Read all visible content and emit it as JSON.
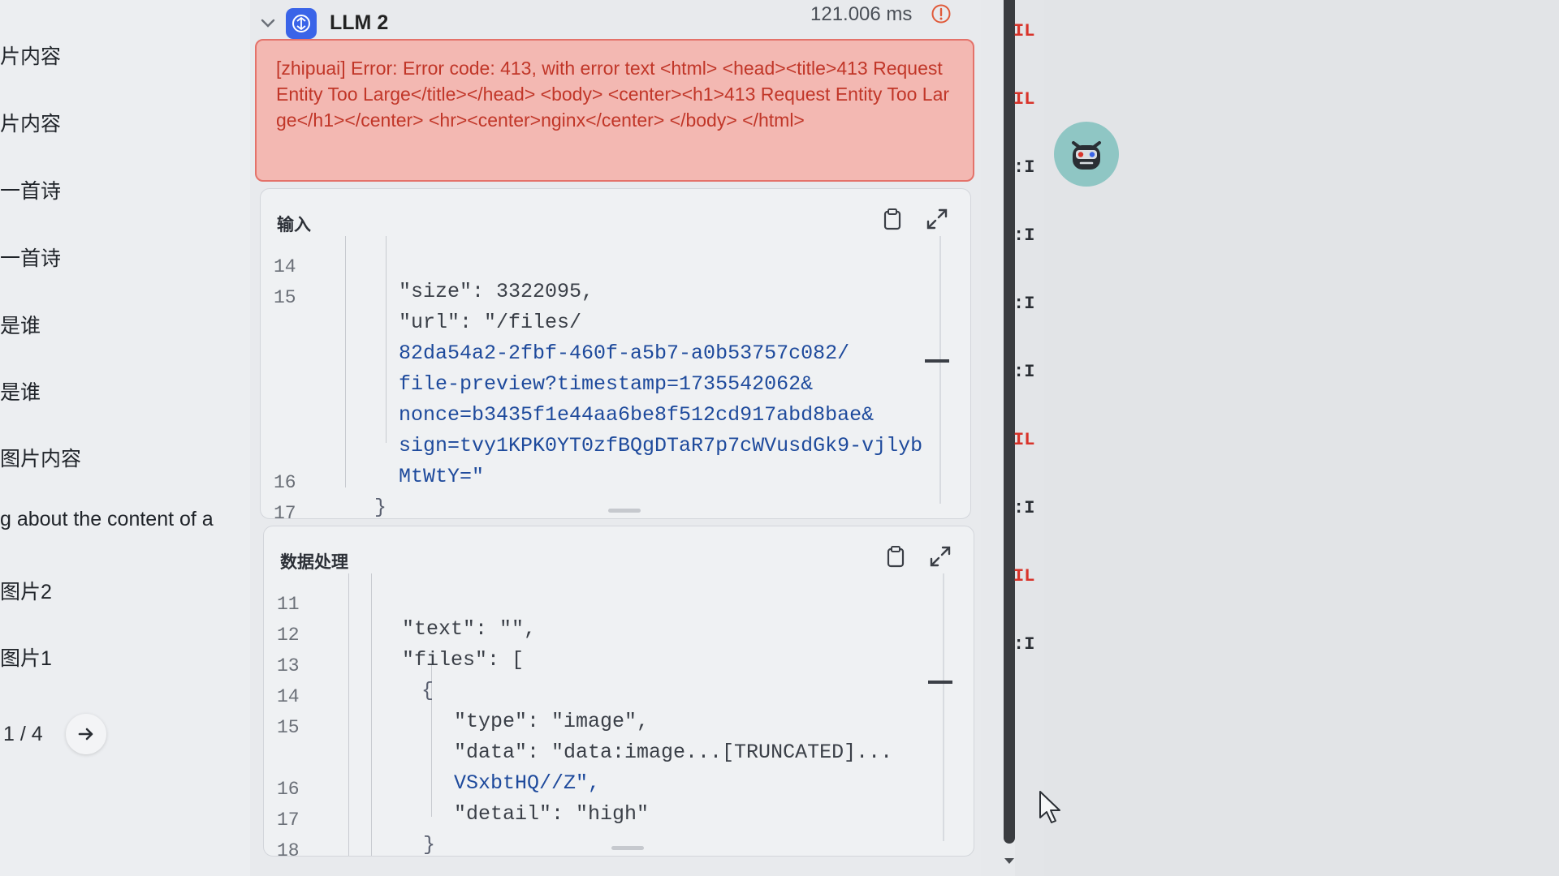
{
  "sidebar": {
    "items": [
      {
        "label": "片内容"
      },
      {
        "label": "片内容"
      },
      {
        "label": "一首诗"
      },
      {
        "label": "一首诗"
      },
      {
        "label": "是谁"
      },
      {
        "label": "是谁"
      },
      {
        "label": "图片内容"
      },
      {
        "label": "g about the content of a"
      },
      {
        "label": "图片2"
      },
      {
        "label": "图片1"
      }
    ],
    "pager": {
      "text": "1 / 4"
    }
  },
  "node": {
    "title": "LLM 2",
    "time": "121.006 ms",
    "error": "[zhipuai] Error: Error code: 413, with error text <html> <head><title>413 Request Entity Too Large</title></head> <body> <center><h1>413 Request Entity Too Large</h1></center> <hr><center>nginx</center> </body> </html>",
    "input": {
      "title": "输入",
      "lines": [
        {
          "ln": "14",
          "text": "\"size\": 3322095,"
        },
        {
          "ln": "15",
          "text": "\"url\": \"/files/"
        },
        {
          "ln": "",
          "text": "82da54a2-2fbf-460f-a5b7-a0b53757c082/"
        },
        {
          "ln": "",
          "text": "file-preview?timestamp=1735542062&"
        },
        {
          "ln": "",
          "text": "nonce=b3435f1e44aa6be8f512cd917abd8bae&"
        },
        {
          "ln": "",
          "text": "sign=tvy1KPK0YT0zfBQgDTaR7p7cWVusdGk9-vjlyb"
        },
        {
          "ln": "",
          "text": "MtWtY=\""
        },
        {
          "ln": "16",
          "text": "}"
        },
        {
          "ln": "17",
          "text": "]"
        }
      ]
    },
    "processing": {
      "title": "数据处理",
      "lines": [
        {
          "ln": "11",
          "text": "\"text\": \"\","
        },
        {
          "ln": "12",
          "text": "\"files\": ["
        },
        {
          "ln": "13",
          "text": "{"
        },
        {
          "ln": "14",
          "text": "\"type\": \"image\","
        },
        {
          "ln": "15",
          "text": "\"data\": \"data:image...[TRUNCATED]..."
        },
        {
          "ln": "",
          "text": "VSxbtHQ//Z\","
        },
        {
          "ln": "16",
          "text": "\"detail\": \"high\""
        },
        {
          "ln": "17",
          "text": "}"
        },
        {
          "ln": "18",
          "text": "]"
        }
      ]
    }
  },
  "log_marks": [
    "IL",
    "IL",
    ":I",
    ":I",
    ":I",
    ":I",
    "IL",
    ":I",
    "IL",
    ":I"
  ],
  "colors": {
    "accent": "#3a64e8",
    "error_bg": "#f3b8b2",
    "error_text": "#c13628",
    "error_mark": "#d8332a",
    "string": "#1e4a9c"
  },
  "icons": {
    "collapse": "chevron-down-icon",
    "node": "llm-node-icon",
    "warning": "warning-circle-icon",
    "copy": "clipboard-icon",
    "expand": "expand-icon",
    "next": "arrow-right-icon",
    "avatar": "robot-avatar-icon"
  }
}
